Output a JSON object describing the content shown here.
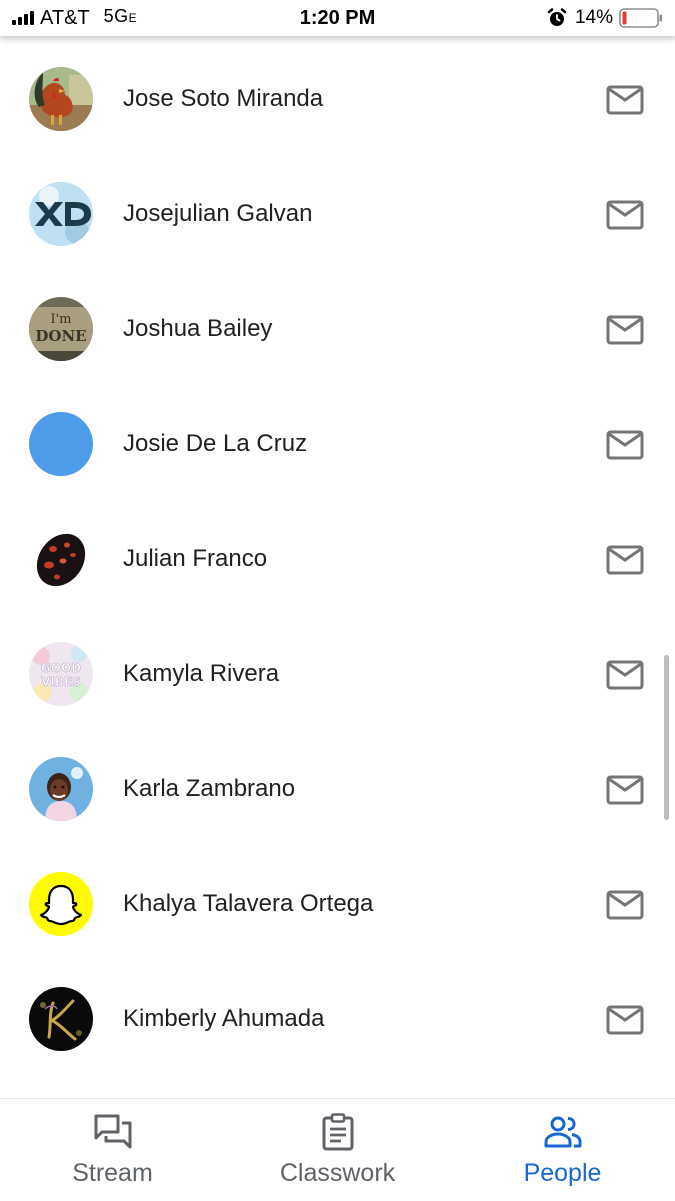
{
  "status_bar": {
    "carrier": "AT&T",
    "network": "5G",
    "network_suffix": "E",
    "time": "1:20 PM",
    "battery": "14%",
    "icons": [
      "signal-icon",
      "alarm-icon",
      "battery-icon"
    ]
  },
  "people": [
    {
      "name": "Jose Soto Miranda",
      "avatar": "rooster-photo"
    },
    {
      "name": "Josejulian Galvan",
      "avatar": "xd-graphic"
    },
    {
      "name": "Joshua Bailey",
      "avatar": "im-done-sign"
    },
    {
      "name": "Josie De La Cruz",
      "avatar": "solid-blue",
      "color": "#4e9bea"
    },
    {
      "name": "Julian Franco",
      "avatar": "spotted-egg"
    },
    {
      "name": "Kamyla Rivera",
      "avatar": "good-vibes-graphic"
    },
    {
      "name": "Karla Zambrano",
      "avatar": "girl-portrait"
    },
    {
      "name": "Khalya Talavera Ortega",
      "avatar": "snapchat-ghost"
    },
    {
      "name": "Kimberly Ahumada",
      "avatar": "letter-k-ornament"
    }
  ],
  "row_action_icon": "email-icon",
  "bottom_nav": {
    "tabs": [
      {
        "label": "Stream",
        "icon": "stream-icon",
        "active": false
      },
      {
        "label": "Classwork",
        "icon": "classwork-icon",
        "active": false
      },
      {
        "label": "People",
        "icon": "people-icon",
        "active": true
      }
    ]
  },
  "colors": {
    "active_tab": "#1967d2",
    "inactive_tab": "#5f6368",
    "icon_gray": "#757575",
    "text": "#202124"
  }
}
